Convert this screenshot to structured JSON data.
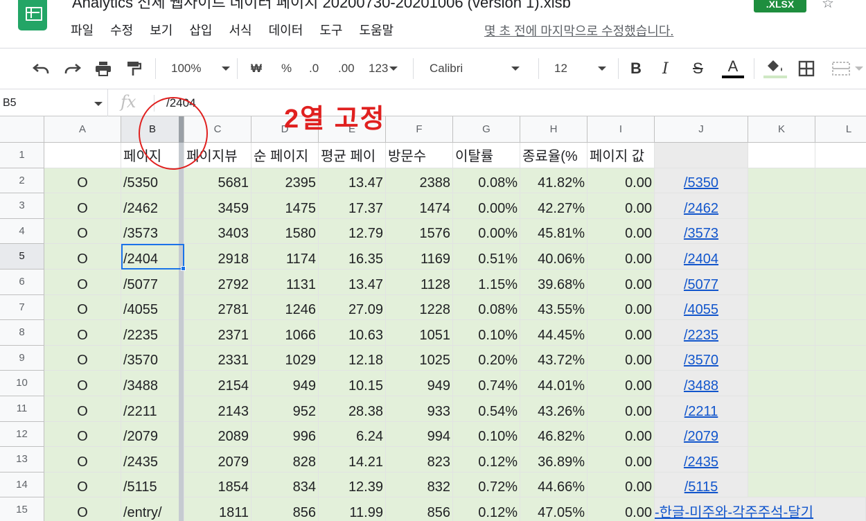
{
  "app": {
    "doc_title": "Analytics 전체 웹사이트 데이터 페이지 20200730-20201006 (version 1).xlsb",
    "file_badge": ".XLSX",
    "last_edit": "몇 초 전에 마지막으로 수정했습니다."
  },
  "menu": [
    "파일",
    "수정",
    "보기",
    "삽입",
    "서식",
    "데이터",
    "도구",
    "도움말"
  ],
  "toolbar": {
    "zoom": "100%",
    "currency": "₩",
    "percent": "%",
    "dec_decrease": ".0",
    "dec_increase": ".00",
    "number_format": "123",
    "font": "Calibri",
    "font_size": "12",
    "bold": "B",
    "italic": "I",
    "strike": "S",
    "text_color": "A"
  },
  "formula_bar": {
    "name_box": "B5",
    "fx": "fx",
    "value": "/2404"
  },
  "columns": [
    "A",
    "B",
    "C",
    "D",
    "E",
    "F",
    "G",
    "H",
    "I",
    "J",
    "K",
    "L"
  ],
  "selected_column": "B",
  "selected_row": "5",
  "annotation": {
    "text": "2열 고정"
  },
  "header_row": [
    "",
    "페이지",
    "페이지뷰",
    "순 페이지",
    "평균 페이",
    "방문수",
    "이탈률",
    "종료율(%",
    "페이지 값",
    "",
    "",
    ""
  ],
  "rows": [
    {
      "num": "2",
      "cells": [
        "O",
        "/5350",
        "5681",
        "2395",
        "13.47",
        "2388",
        "0.08%",
        "41.82%",
        "0.00",
        "/5350"
      ]
    },
    {
      "num": "3",
      "cells": [
        "O",
        "/2462",
        "3459",
        "1475",
        "17.37",
        "1474",
        "0.00%",
        "42.27%",
        "0.00",
        "/2462"
      ]
    },
    {
      "num": "4",
      "cells": [
        "O",
        "/3573",
        "3403",
        "1580",
        "12.79",
        "1576",
        "0.00%",
        "45.81%",
        "0.00",
        "/3573"
      ]
    },
    {
      "num": "5",
      "cells": [
        "O",
        "/2404",
        "2918",
        "1174",
        "16.35",
        "1169",
        "0.51%",
        "40.06%",
        "0.00",
        "/2404"
      ]
    },
    {
      "num": "6",
      "cells": [
        "O",
        "/5077",
        "2792",
        "1131",
        "13.47",
        "1128",
        "1.15%",
        "39.68%",
        "0.00",
        "/5077"
      ]
    },
    {
      "num": "7",
      "cells": [
        "O",
        "/4055",
        "2781",
        "1246",
        "27.09",
        "1228",
        "0.08%",
        "43.55%",
        "0.00",
        "/4055"
      ]
    },
    {
      "num": "8",
      "cells": [
        "O",
        "/2235",
        "2371",
        "1066",
        "10.63",
        "1051",
        "0.10%",
        "44.45%",
        "0.00",
        "/2235"
      ]
    },
    {
      "num": "9",
      "cells": [
        "O",
        "/3570",
        "2331",
        "1029",
        "12.18",
        "1025",
        "0.20%",
        "43.72%",
        "0.00",
        "/3570"
      ]
    },
    {
      "num": "10",
      "cells": [
        "O",
        "/3488",
        "2154",
        "949",
        "10.15",
        "949",
        "0.74%",
        "44.01%",
        "0.00",
        "/3488"
      ]
    },
    {
      "num": "11",
      "cells": [
        "O",
        "/2211",
        "2143",
        "952",
        "28.38",
        "933",
        "0.54%",
        "43.26%",
        "0.00",
        "/2211"
      ]
    },
    {
      "num": "12",
      "cells": [
        "O",
        "/2079",
        "2089",
        "996",
        "6.24",
        "994",
        "0.10%",
        "46.82%",
        "0.00",
        "/2079"
      ]
    },
    {
      "num": "13",
      "cells": [
        "O",
        "/2435",
        "2079",
        "828",
        "14.21",
        "823",
        "0.12%",
        "36.89%",
        "0.00",
        "/2435"
      ]
    },
    {
      "num": "14",
      "cells": [
        "O",
        "/5115",
        "1854",
        "834",
        "12.39",
        "832",
        "0.72%",
        "44.66%",
        "0.00",
        "/5115"
      ]
    },
    {
      "num": "15",
      "cells": [
        "O",
        "/entry/",
        "1811",
        "856",
        "11.99",
        "856",
        "0.12%",
        "47.05%",
        "0.00",
        "-한글-미주와-각주주석-달기"
      ]
    }
  ],
  "colors": {
    "green_fill": "#e3f0da",
    "gray_fill": "#ebebeb",
    "link": "#1155cc",
    "selection": "#1a73e8",
    "annotation": "#e0201f"
  }
}
